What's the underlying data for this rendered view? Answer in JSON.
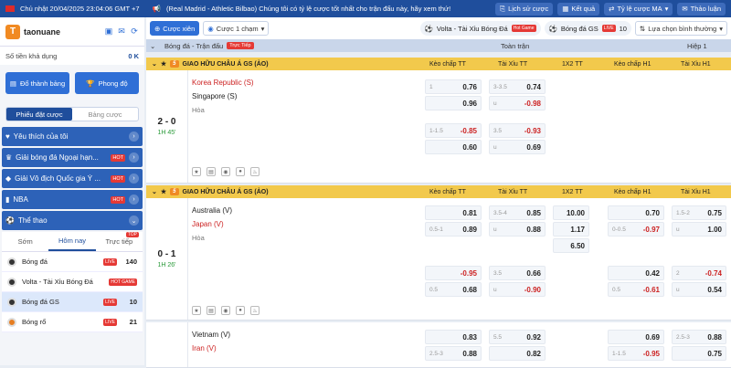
{
  "topbar": {
    "datetime": "Chủ nhật 20/04/2025 23:04:06 GMT +7",
    "ticker": "(Real Madrid - Athletic Bilbao) Chúng tôi có tỷ lệ cược tốt nhất cho trận đấu này, hãy xem thứ!",
    "buttons": [
      "Lịch sử cược",
      "Kết quả",
      "Tỷ lệ cược MA",
      "Thảo luận"
    ]
  },
  "user": {
    "initial": "T",
    "name": "taonuane",
    "balance_label": "Số tiền khả dụng",
    "balance_value": "0 K"
  },
  "side_buttons": [
    "Đổ thành bảng",
    "Phong độ"
  ],
  "bet_tabs": [
    "Phiếu đặt cược",
    "Bảng cược"
  ],
  "menu": [
    {
      "label": "Yêu thích của tôi",
      "hot": ""
    },
    {
      "label": "Giải bóng đá Ngoại hạn...",
      "hot": "HOT"
    },
    {
      "label": "Giải Vô địch Quốc gia Ý ...",
      "hot": "HOT"
    },
    {
      "label": "NBA",
      "hot": "HOT"
    },
    {
      "label": "Thể thao",
      "hot": ""
    }
  ],
  "sport_tabs": [
    "Sớm",
    "Hôm nay",
    "Trực tiếp"
  ],
  "sport_tab_badge": "TOP",
  "sports": [
    {
      "label": "Bóng đá",
      "badge": "LIVE",
      "count": "140"
    },
    {
      "label": "Volta - Tài Xỉu Bóng Đá",
      "badge": "HOT GAME",
      "count": ""
    },
    {
      "label": "Bóng đá GS",
      "badge": "LIVE",
      "count": "10"
    },
    {
      "label": "Bóng rổ",
      "badge": "LIVE",
      "count": "21"
    }
  ],
  "toolbar": {
    "bet_type": "Cược xiên",
    "click_label": "Cược 1 chạm",
    "volta": "Volta - Tài Xỉu Bóng Đá",
    "volta_badge": "Hot Game",
    "gs": "Bóng đá GS",
    "gs_badge": "LIVE",
    "gs_count": "10",
    "sort": "Lựa chọn bình thường"
  },
  "header": {
    "title": "Bóng đá - Trận đấu",
    "live": "Trực Tiếp",
    "full": "Toàn trận",
    "half": "Hiệp 1"
  },
  "columns": [
    "Kèo chấp TT",
    "Tài Xỉu TT",
    "1X2 TT",
    "Kèo chấp H1",
    "Tài Xỉu H1"
  ],
  "leagues": [
    {
      "logo": "5",
      "name": "GIAO HỮU CHÂU Á GS (ẢO)"
    },
    {
      "logo": "5",
      "name": "GIAO HỮU CHÂU Á GS (ẢO)"
    }
  ],
  "matches": [
    {
      "score": "2 - 0",
      "time": "1H 45'",
      "home": "Korea Republic (S)",
      "away": "Singapore (S)",
      "draw": "Hòa",
      "rows": [
        {
          "hc_h": "1",
          "hc_a": "0.76",
          "hc_b": "0.96",
          "ou_h": "3-3.5",
          "ou_a": "0.74",
          "ou_u": "u",
          "ou_b": "-0.98"
        },
        {
          "hc_h": "1-1.5",
          "hc_a": "-0.85",
          "hc_b": "0.60",
          "ou_h": "3.5",
          "ou_a": "-0.93",
          "ou_u": "u",
          "ou_b": "0.69"
        }
      ]
    },
    {
      "score": "0 - 1",
      "time": "1H 26'",
      "home": "Australia (V)",
      "away": "Japan (V)",
      "draw": "Hòa",
      "rows": [
        {
          "hc_h": "0.5-1",
          "hc_a": "0.81",
          "hc_b": "0.89",
          "ou_h": "3.5-4",
          "ou_a": "0.85",
          "ou_u": "u",
          "ou_b": "0.88",
          "x1": "10.00",
          "x2": "1.17",
          "x3": "6.50",
          "h1_h": "0-0.5",
          "h1_a": "0.70",
          "h1_b": "-0.97",
          "h1ou_h": "1.5-2",
          "h1ou_a": "0.75",
          "h1ou_u": "u",
          "h1ou_b": "1.00"
        },
        {
          "hc_h": "0.5",
          "hc_a": "-0.95",
          "hc_b": "0.68",
          "ou_h": "3.5",
          "ou_a": "0.66",
          "ou_u": "u",
          "ou_b": "-0.90",
          "h1_h": "0.5",
          "h1_a": "0.42",
          "h1_b": "-0.61",
          "h1ou_h": "2",
          "h1ou_a": "-0.74",
          "h1ou_u": "u",
          "h1ou_b": "0.54"
        }
      ]
    },
    {
      "score": "",
      "time": "",
      "home": "Vietnam (V)",
      "away": "Iran (V)",
      "draw": "",
      "rows": [
        {
          "hc_h": "2.5-3",
          "hc_a": "0.83",
          "hc_b": "0.88",
          "ou_h": "5.5",
          "ou_a": "0.92",
          "ou_u": "",
          "ou_b": "0.82",
          "h1_h": "1-1.5",
          "h1_a": "0.69",
          "h1_b": "-0.95",
          "h1ou_h": "2.5-3",
          "h1ou_a": "0.88",
          "h1ou_b": "0.75"
        }
      ]
    }
  ]
}
